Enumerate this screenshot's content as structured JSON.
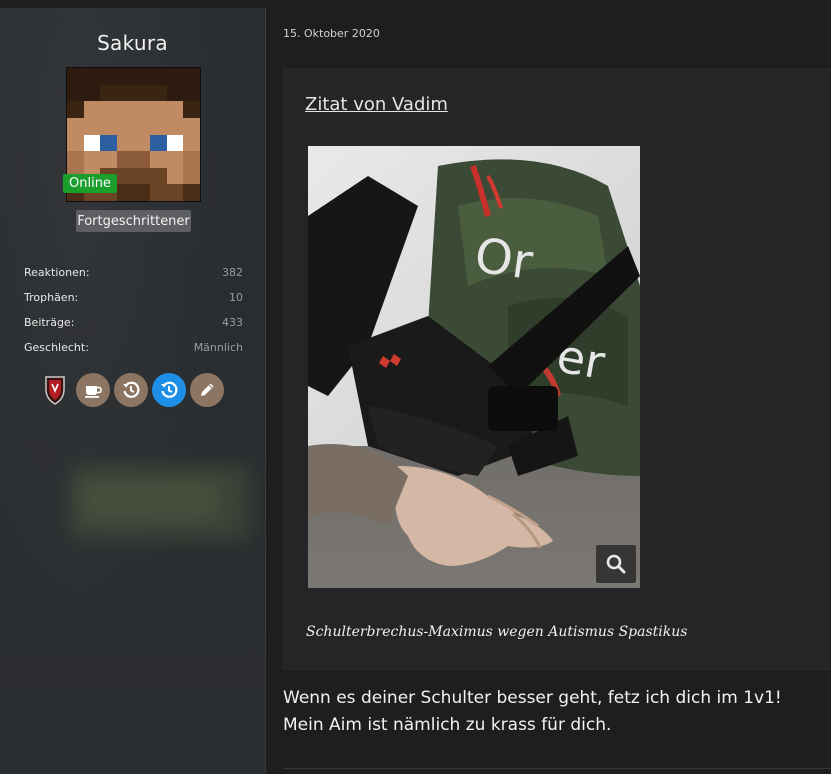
{
  "user": {
    "name": "Sakura",
    "online_label": "Online",
    "rank": "Fortgeschrittener",
    "avatar_icon": "minecraft-steve-skin",
    "stats": [
      {
        "label": "Reaktionen:",
        "value": "382"
      },
      {
        "label": "Trophäen:",
        "value": "10"
      },
      {
        "label": "Beiträge:",
        "value": "433"
      },
      {
        "label": "Geschlecht:",
        "value": "Männlich"
      }
    ],
    "icons": [
      "clan-shield-icon",
      "coffee-icon",
      "history-icon",
      "history-icon-active",
      "pencil-icon"
    ]
  },
  "post": {
    "date": "15. Oktober 2020",
    "quote": {
      "title": "Zitat von Vadim",
      "image_icon": "photo-shoulder-brace",
      "caption": "Schulterbrechus-Maximus wegen Autismus Spastikus"
    },
    "lines": [
      "Wenn es deiner Schulter besser geht, fetz ich dich im 1v1!",
      "Mein Aim ist nämlich zu krass für dich."
    ]
  },
  "colors": {
    "online": "#1a9e2c",
    "rank_bg": "#5d5f62",
    "accent_blue": "#1e8fe6",
    "icon_brown": "#8c7663"
  }
}
